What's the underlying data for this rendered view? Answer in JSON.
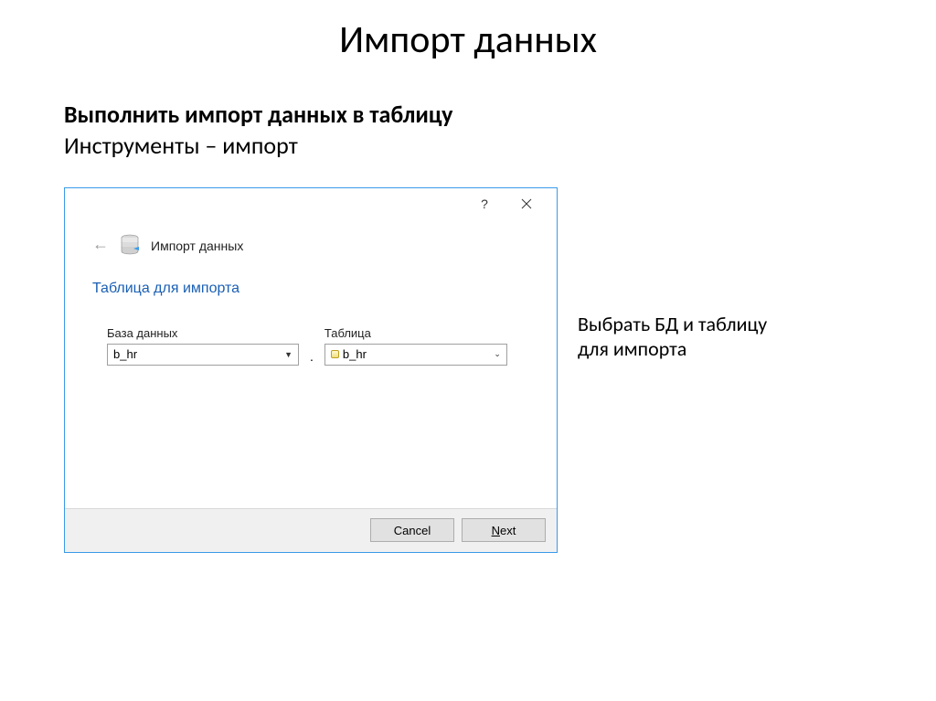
{
  "slide": {
    "title": "Импорт данных",
    "instruction_bold": "Выполнить импорт данных в таблицу",
    "instruction_regular": "Инструменты – импорт"
  },
  "dialog": {
    "breadcrumb": "Импорт данных",
    "section_title": "Таблица для импорта",
    "database_label": "База данных",
    "database_value": "b_hr",
    "table_label": "Таблица",
    "table_value": "b_hr",
    "cancel_label": "Cancel",
    "next_prefix": "N",
    "next_rest": "ext"
  },
  "side_note": {
    "line1": "Выбрать БД и таблицу",
    "line2": "для импорта"
  }
}
